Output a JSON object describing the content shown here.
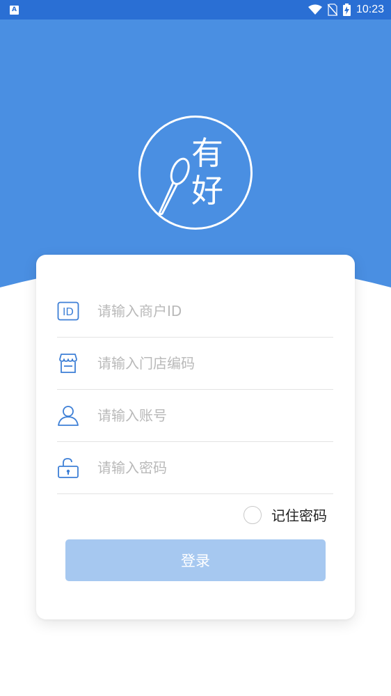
{
  "status_bar": {
    "app_badge": "A",
    "time": "10:23"
  },
  "brand": {
    "logo_char_1": "有",
    "logo_char_2": "好",
    "primary_color": "#4a8fe2",
    "status_bar_color": "#2a6fd4"
  },
  "form": {
    "merchant_id": {
      "placeholder": "请输入商户ID",
      "value": "",
      "icon": "id-card-icon"
    },
    "store_code": {
      "placeholder": "请输入门店编码",
      "value": "",
      "icon": "store-icon"
    },
    "account": {
      "placeholder": "请输入账号",
      "value": "",
      "icon": "user-icon"
    },
    "password": {
      "placeholder": "请输入密码",
      "value": "",
      "icon": "lock-icon"
    },
    "remember_label": "记住密码",
    "remember_checked": false,
    "login_label": "登录",
    "login_button_color": "#a6c8f0"
  }
}
